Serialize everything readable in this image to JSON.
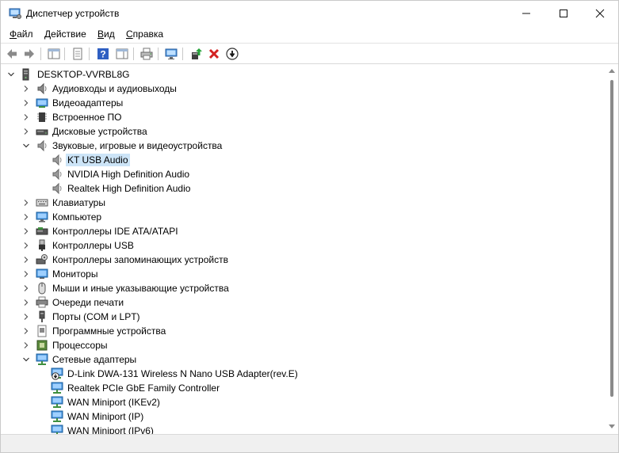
{
  "window": {
    "title": "Диспетчер устройств"
  },
  "menu": {
    "file": {
      "accel": "Ф",
      "rest": "айл"
    },
    "action": {
      "accel": "Д",
      "rest": "ействие"
    },
    "view": {
      "accel": "В",
      "rest": "ид"
    },
    "help": {
      "accel": "С",
      "rest": "правка"
    }
  },
  "toolbar": {
    "buttons": [
      "back-icon",
      "forward-icon",
      "show-hide-console-tree-icon",
      "properties-icon",
      "help-icon",
      "details-pane-icon",
      "print-icon",
      "scan-hardware-icon",
      "update-driver-icon",
      "uninstall-icon",
      "disable-icon"
    ]
  },
  "tree": {
    "root": "DESKTOP-VVRBL8G",
    "nodes": [
      {
        "label": "Аудиовходы и аудиовыходы",
        "icon": "audio-io-icon",
        "expanded": false
      },
      {
        "label": "Видеоадаптеры",
        "icon": "display-adapter-icon",
        "expanded": false
      },
      {
        "label": "Встроенное ПО",
        "icon": "firmware-icon",
        "expanded": false
      },
      {
        "label": "Дисковые устройства",
        "icon": "disk-drive-icon",
        "expanded": false
      },
      {
        "label": "Звуковые, игровые и видеоустройства",
        "icon": "sound-icon",
        "expanded": true
      },
      {
        "label": "KT USB Audio",
        "icon": "speaker-icon",
        "child": true,
        "selected": true
      },
      {
        "label": "NVIDIA High Definition Audio",
        "icon": "speaker-icon",
        "child": true
      },
      {
        "label": "Realtek High Definition Audio",
        "icon": "speaker-icon",
        "child": true
      },
      {
        "label": "Клавиатуры",
        "icon": "keyboard-icon",
        "expanded": false
      },
      {
        "label": "Компьютер",
        "icon": "computer-icon",
        "expanded": false
      },
      {
        "label": "Контроллеры IDE ATA/ATAPI",
        "icon": "ide-controller-icon",
        "expanded": false
      },
      {
        "label": "Контроллеры USB",
        "icon": "usb-icon",
        "expanded": false
      },
      {
        "label": "Контроллеры запоминающих устройств",
        "icon": "storage-controller-icon",
        "expanded": false
      },
      {
        "label": "Мониторы",
        "icon": "monitor-icon",
        "expanded": false
      },
      {
        "label": "Мыши и иные указывающие устройства",
        "icon": "mouse-icon",
        "expanded": false
      },
      {
        "label": "Очереди печати",
        "icon": "printer-icon",
        "expanded": false
      },
      {
        "label": "Порты (COM и LPT)",
        "icon": "port-icon",
        "expanded": false
      },
      {
        "label": "Программные устройства",
        "icon": "software-device-icon",
        "expanded": false
      },
      {
        "label": "Процессоры",
        "icon": "processor-icon",
        "expanded": false
      },
      {
        "label": "Сетевые адаптеры",
        "icon": "network-adapter-icon",
        "expanded": true
      },
      {
        "label": "D-Link DWA-131 Wireless N Nano USB Adapter(rev.E)",
        "icon": "network-adapter-disabled-icon",
        "child": true
      },
      {
        "label": "Realtek PCIe GbE Family Controller",
        "icon": "network-adapter-icon",
        "child": true
      },
      {
        "label": "WAN Miniport (IKEv2)",
        "icon": "network-adapter-icon",
        "child": true
      },
      {
        "label": "WAN Miniport (IP)",
        "icon": "network-adapter-icon",
        "child": true
      },
      {
        "label": "WAN Miniport (IPv6)",
        "icon": "network-adapter-icon",
        "child": true
      }
    ]
  },
  "colors": {
    "selection": "#cce4f7",
    "uninstall_red": "#d32121",
    "help_blue": "#2f5fc2"
  }
}
